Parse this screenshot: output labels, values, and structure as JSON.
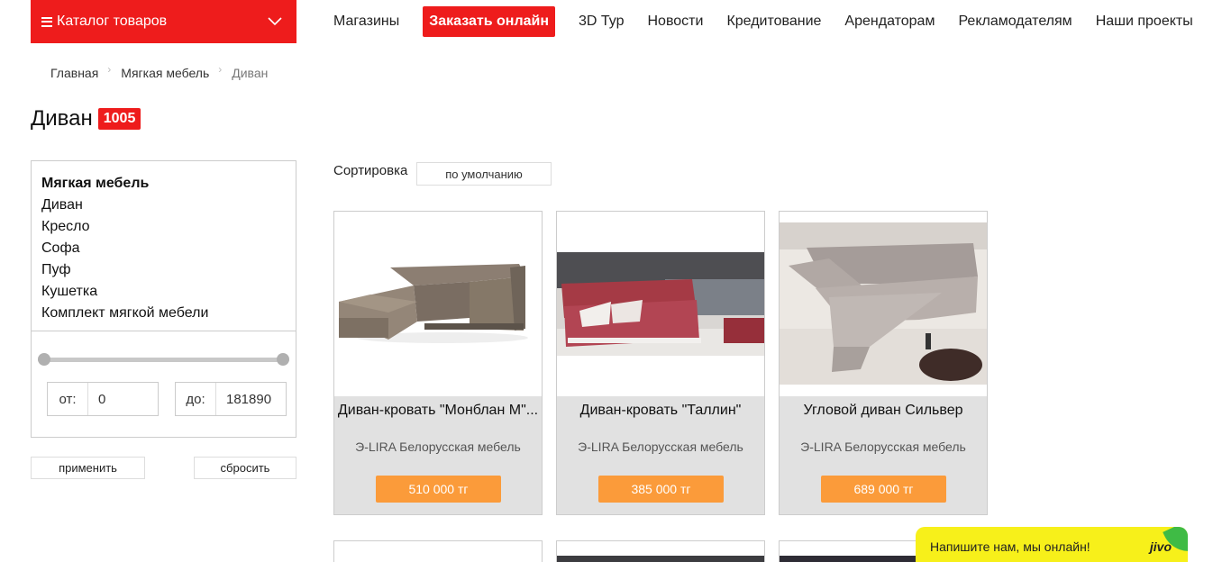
{
  "header": {
    "catalog_label": "Каталог товаров",
    "nav": [
      {
        "label": "Магазины",
        "highlight": false
      },
      {
        "label": "Заказать онлайн",
        "highlight": true
      },
      {
        "label": "3D Тур",
        "highlight": false
      },
      {
        "label": "Новости",
        "highlight": false
      },
      {
        "label": "Кредитование",
        "highlight": false
      },
      {
        "label": "Арендаторам",
        "highlight": false
      },
      {
        "label": "Рекламодателям",
        "highlight": false
      },
      {
        "label": "Наши проекты",
        "highlight": false
      }
    ]
  },
  "breadcrumb": [
    "Главная",
    "Мягкая мебель",
    "Диван"
  ],
  "page": {
    "title": "Диван",
    "count": "1005"
  },
  "filter": {
    "categories": [
      "Мягкая мебель",
      "Диван",
      "Кресло",
      "Софа",
      "Пуф",
      "Кушетка",
      "Комплект мягкой мебели"
    ],
    "price_from_label": "от:",
    "price_from": "0",
    "price_to_label": "до:",
    "price_to": "181890",
    "apply_label": "применить",
    "reset_label": "сбросить"
  },
  "sort": {
    "label": "Сортировка",
    "value": "по умолчанию"
  },
  "products": [
    {
      "name": "Диван-кровать \"Монблан М\"...",
      "brand": "Э-LIRA Белорусская мебель",
      "price": "510 000 тг"
    },
    {
      "name": "Диван-кровать \"Таллин\"",
      "brand": "Э-LIRA Белорусская мебель",
      "price": "385 000 тг"
    },
    {
      "name": "Угловой диван Сильвер",
      "brand": "Э-LIRA Белорусская мебель",
      "price": "689 000 тг"
    }
  ],
  "chat": {
    "text": "Напишите нам, мы онлайн!",
    "brand": "jivo"
  },
  "colors": {
    "accent": "#ee1c1c",
    "price": "#fb9b3a",
    "chat": "#f7f01a"
  }
}
